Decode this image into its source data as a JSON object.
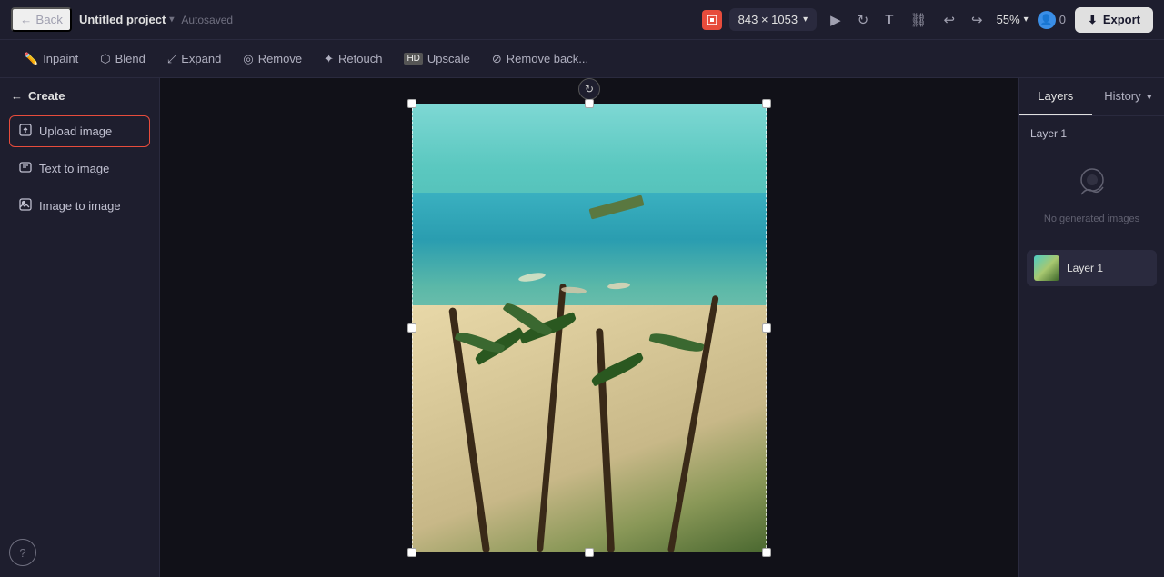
{
  "topbar": {
    "back_label": "Back",
    "project_name": "Untitled project",
    "autosaved": "Autosaved",
    "canvas_size": "843 × 1053",
    "zoom_level": "55%",
    "collab_count": "0",
    "export_label": "Export"
  },
  "toolstrip": {
    "inpaint_label": "Inpaint",
    "blend_label": "Blend",
    "expand_label": "Expand",
    "remove_label": "Remove",
    "retouch_label": "Retouch",
    "upscale_label": "Upscale",
    "remove_bg_label": "Remove back..."
  },
  "sidebar": {
    "create_label": "Create",
    "upload_image_label": "Upload image",
    "text_to_image_label": "Text to image",
    "image_to_image_label": "Image to image"
  },
  "right_panel": {
    "layers_tab": "Layers",
    "history_tab": "History",
    "layer1_label": "Layer 1",
    "no_images_text": "No generated images",
    "layer_item_name": "Layer 1"
  }
}
